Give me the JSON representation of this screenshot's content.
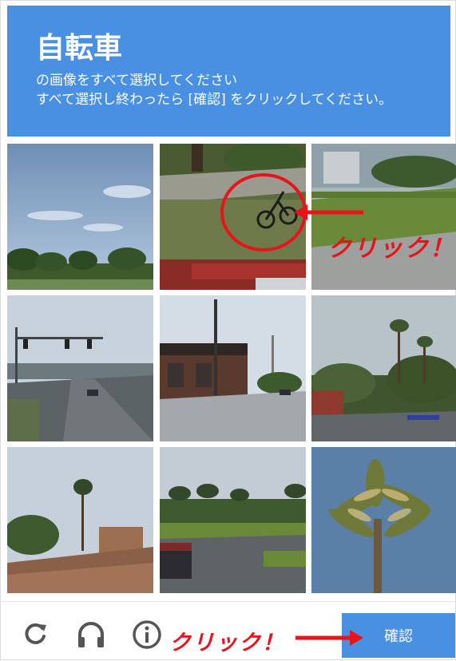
{
  "header": {
    "title": "自転車",
    "line1": "の画像をすべて選択してください",
    "line2": "すべて選択し終わったら [確認] をクリックしてください。",
    "background": "#4a90e2"
  },
  "grid": {
    "tiles": [
      {
        "id": 1,
        "scene": "sky-trees"
      },
      {
        "id": 2,
        "scene": "bicycle-on-grass",
        "highlighted": true
      },
      {
        "id": 3,
        "scene": "road-lawn"
      },
      {
        "id": 4,
        "scene": "highway-traffic-lights"
      },
      {
        "id": 5,
        "scene": "intersection-building"
      },
      {
        "id": 6,
        "scene": "palm-street"
      },
      {
        "id": 7,
        "scene": "rooftop-palm"
      },
      {
        "id": 8,
        "scene": "palms-road-car"
      },
      {
        "id": 9,
        "scene": "palm-top-sky"
      }
    ]
  },
  "footer": {
    "reload_icon": "reload-icon",
    "audio_icon": "headphones-icon",
    "info_icon": "info-icon",
    "verify_label": "確認",
    "verify_color": "#4a90e2"
  },
  "annotations": {
    "click_label_1": "クリック！",
    "click_label_2": "クリック！",
    "color": "#e8141b"
  }
}
